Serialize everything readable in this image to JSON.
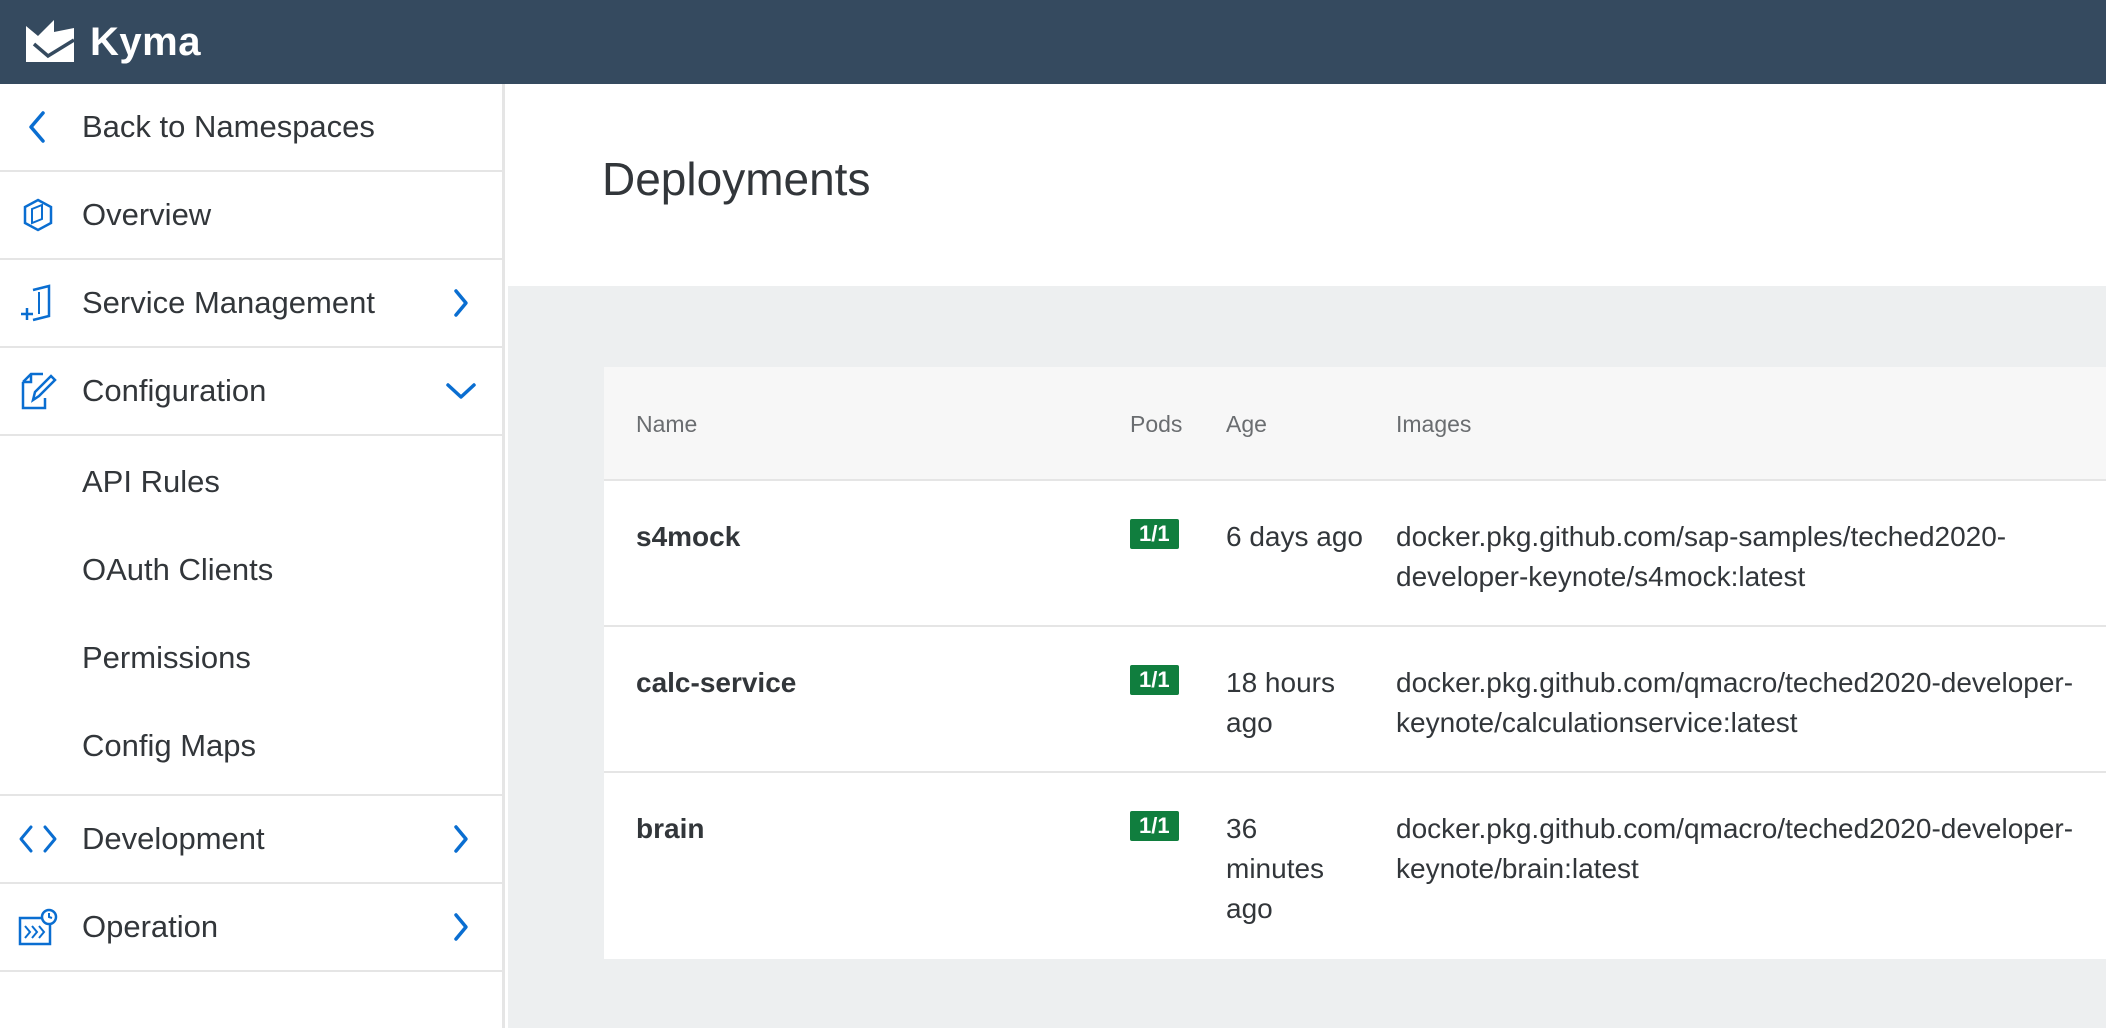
{
  "app": {
    "brand": "Kyma",
    "accent_color": "#0a6ed1",
    "header_color": "#354a5f",
    "status_green": "#107e3e"
  },
  "sidebar": {
    "back_label": "Back to Namespaces",
    "items": [
      {
        "label": "Overview",
        "icon": "overview-icon"
      },
      {
        "label": "Service Management",
        "icon": "service-management-icon",
        "arrow": "chevron-right"
      },
      {
        "label": "Configuration",
        "icon": "configuration-icon",
        "arrow": "chevron-down"
      },
      {
        "label": "Development",
        "icon": "development-icon",
        "arrow": "chevron-right"
      },
      {
        "label": "Operation",
        "icon": "operation-icon",
        "arrow": "chevron-right"
      }
    ],
    "configuration_children": [
      {
        "label": "API Rules"
      },
      {
        "label": "OAuth Clients"
      },
      {
        "label": "Permissions"
      },
      {
        "label": "Config Maps"
      }
    ]
  },
  "main": {
    "title": "Deployments",
    "table": {
      "headers": {
        "name": "Name",
        "pods": "Pods",
        "age": "Age",
        "images": "Images"
      },
      "rows": [
        {
          "name": "s4mock",
          "pods": "1/1",
          "age": "6 days ago",
          "image": "docker.pkg.github.com/sap-samples/teched2020-developer-keynote/s4mock:latest"
        },
        {
          "name": "calc-service",
          "pods": "1/1",
          "age": "18 hours ago",
          "image": "docker.pkg.github.com/qmacro/teched2020-developer-keynote/calculationservice:latest"
        },
        {
          "name": "brain",
          "pods": "1/1",
          "age": "36 minutes ago",
          "image": "docker.pkg.github.com/qmacro/teched2020-developer-keynote/brain:latest"
        }
      ]
    }
  }
}
